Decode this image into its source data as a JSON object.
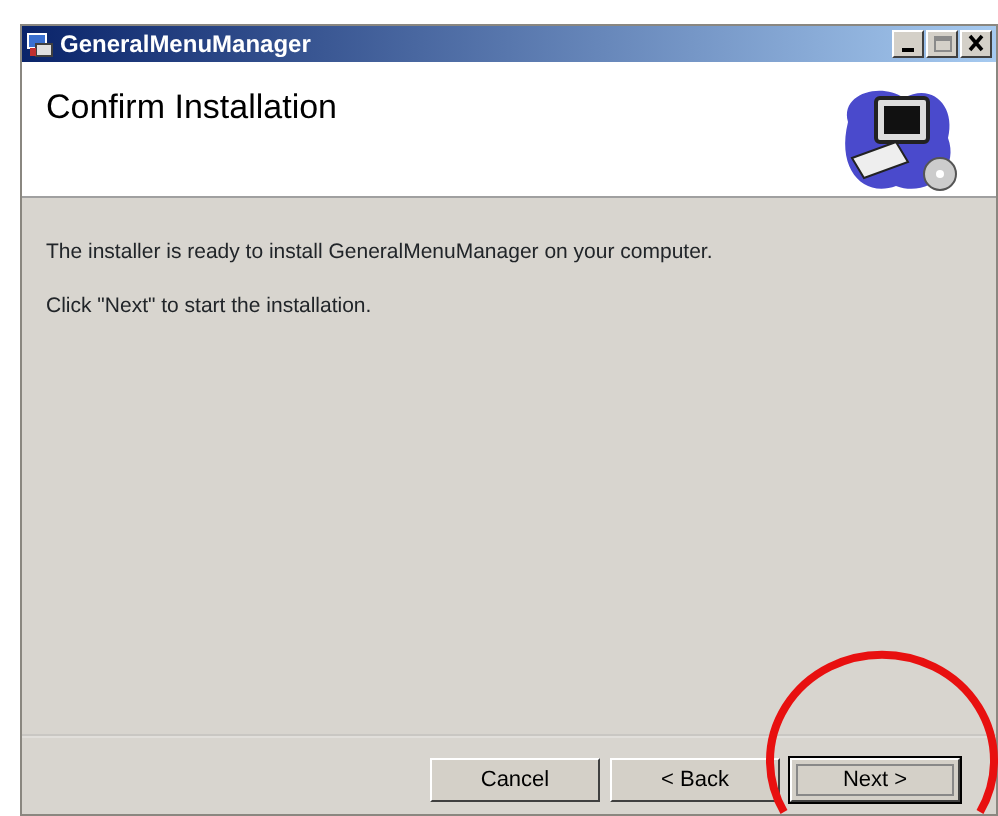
{
  "window": {
    "title": "GeneralMenuManager",
    "controls": [
      {
        "kind": "minimize",
        "disabled": false
      },
      {
        "kind": "maximize",
        "disabled": true
      },
      {
        "kind": "close",
        "disabled": false
      }
    ]
  },
  "header": {
    "title": "Confirm Installation"
  },
  "body": {
    "paragraphs": [
      "The installer is ready to install GeneralMenuManager on your computer.",
      "Click \"Next\" to start the installation."
    ]
  },
  "buttons": [
    {
      "label": "Cancel",
      "default": false
    },
    {
      "label": "< Back",
      "default": false
    },
    {
      "label": "Next >",
      "default": true
    }
  ],
  "annotation": {
    "kind": "circle",
    "color": "#e81010"
  }
}
